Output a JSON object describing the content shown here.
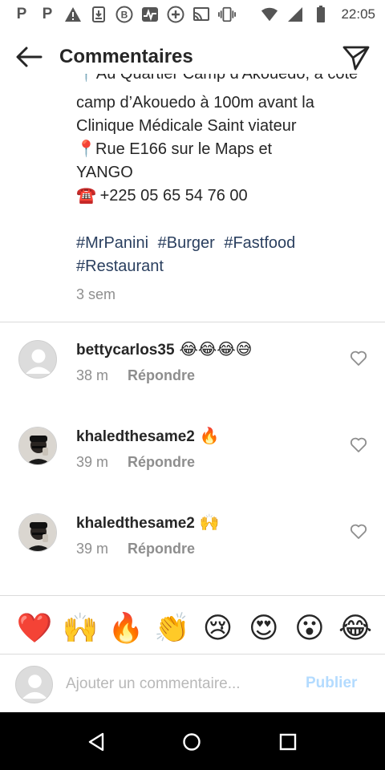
{
  "status_bar": {
    "time": "22:05",
    "left_icons": [
      "parking-icon",
      "parking-icon",
      "warning-icon",
      "download-icon",
      "b-circle-icon",
      "activity-icon",
      "plus-circle-icon",
      "cast-icon",
      "vibrate-icon"
    ],
    "right_icons": [
      "wifi-icon",
      "signal-icon",
      "battery-icon"
    ]
  },
  "header": {
    "title": "Commentaires"
  },
  "caption": {
    "line_clipped": "📍Au Quartier Camp d'Akouedo, à côté du",
    "line1": "camp d’Akouedo à 100m avant la",
    "line2": "Clinique Médicale Saint viateur",
    "line3_emoji": "📍",
    "line3_text": "Rue E166 sur le Maps et",
    "line4": "YANGO",
    "line5_emoji": "☎️",
    "line5_text": "+225 05 65 54 76 00",
    "hashtags": [
      "#MrPanini",
      "#Burger",
      "#Fastfood",
      "#Restaurant"
    ],
    "time": "3 sem"
  },
  "comments": [
    {
      "username": "bettycarlos35",
      "emoji": "😂😂😂😅",
      "time": "38 m",
      "reply_label": "Répondre",
      "avatar": "placeholder"
    },
    {
      "username": "khaledthesame2",
      "emoji": "🔥",
      "time": "39 m",
      "reply_label": "Répondre",
      "avatar": "photo"
    },
    {
      "username": "khaledthesame2",
      "emoji": "🙌",
      "time": "39 m",
      "reply_label": "Répondre",
      "avatar": "photo"
    }
  ],
  "reactions": [
    "❤️",
    "🙌",
    "🔥",
    "👏",
    "😢",
    "😍",
    "😮",
    "😂"
  ],
  "input": {
    "placeholder": "Ajouter un commentaire...",
    "value": "",
    "publish_label": "Publier"
  },
  "colors": {
    "hashtag": "#2a3f5f",
    "muted": "#8e8e8e",
    "publish_disabled": "#b3dbff",
    "text": "#262626"
  }
}
